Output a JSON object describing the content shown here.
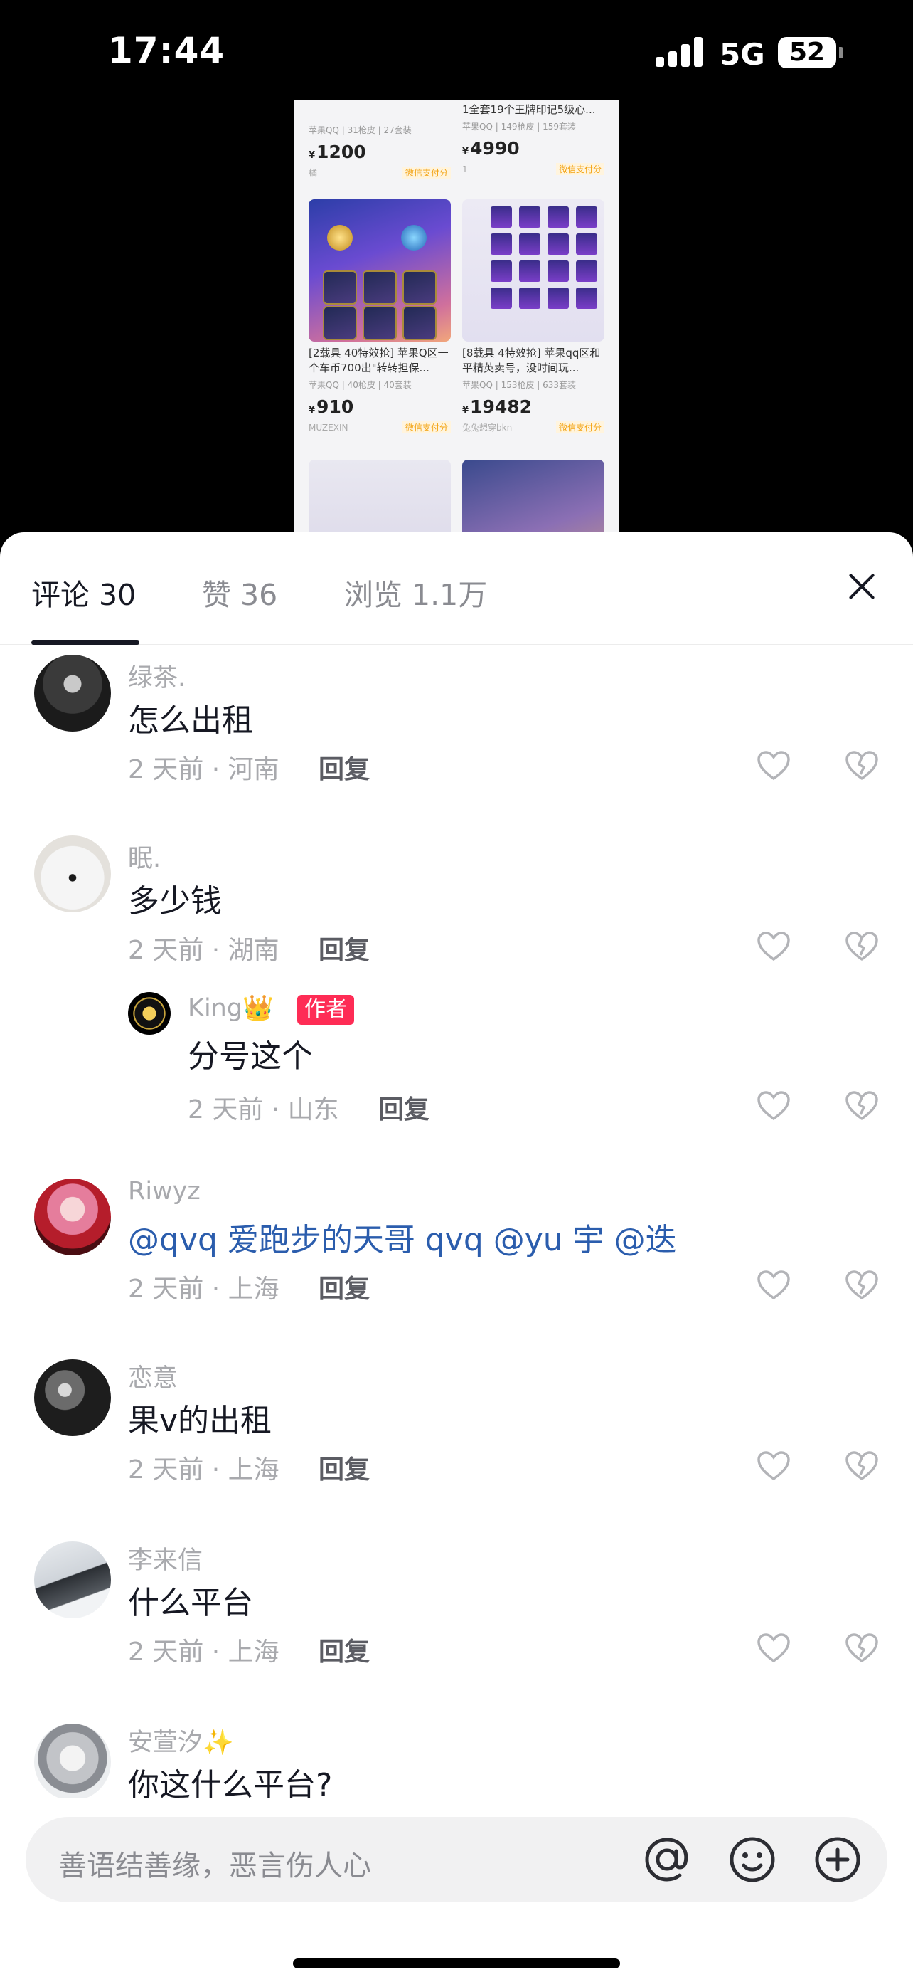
{
  "status_bar": {
    "time": "17:44",
    "network": "5G",
    "battery": "52"
  },
  "preview": {
    "cards": [
      {
        "title": "",
        "meta": "苹果QQ | 31枪皮 | 27套装",
        "price": "1200",
        "seller": "橘",
        "pay": "微信支付分"
      },
      {
        "title": "1全套19个王牌印记5级心...",
        "meta": "苹果QQ | 149枪皮 | 159套装",
        "price": "4990",
        "seller": "1",
        "pay": "微信支付分"
      },
      {
        "title": "[2载具 40特效抢] 苹果Q区一个车币700出\"转转担保...",
        "meta": "苹果QQ | 40枪皮 | 40套装",
        "price": "910",
        "seller": "MUZEXIN",
        "pay": "微信支付分"
      },
      {
        "title": "[8载具 4特效抢] 苹果qq区和平精英卖号，没时间玩...",
        "meta": "苹果QQ | 153枪皮 | 633套装",
        "price": "19482",
        "seller": "兔兔想穿bkn",
        "pay": "微信支付分"
      }
    ],
    "currency": "¥"
  },
  "tabs": {
    "comments": "评论 30",
    "likes": "赞 36",
    "views": "浏览 1.1万"
  },
  "comments": [
    {
      "user": "绿茶.",
      "text": "怎么出租",
      "meta": "2 天前 · 河南",
      "reply": "回复"
    },
    {
      "user": "眠.",
      "text": "多少钱",
      "meta": "2 天前 · 湖南",
      "reply": "回复",
      "sub": {
        "user": "King👑",
        "badge": "作者",
        "text": "分号这个",
        "meta": "2 天前 · 山东",
        "reply": "回复"
      }
    },
    {
      "user": "Riwyz",
      "text": "@qvq 爱跑步的天哥 qvq @yu 宇 @迭",
      "meta": "2 天前 · 上海",
      "reply": "回复"
    },
    {
      "user": "恋意",
      "text": "果v的出租",
      "meta": "2 天前 · 上海",
      "reply": "回复"
    },
    {
      "user": "李来信",
      "text": "什么平台",
      "meta": "2 天前 · 上海",
      "reply": "回复"
    },
    {
      "user": "安萱汐✨",
      "text": "你这什么平台?",
      "meta": "",
      "reply": ""
    }
  ],
  "input": {
    "placeholder": "善语结善缘，恶言伤人心"
  },
  "icons": {
    "like": "heart-outline-icon",
    "dislike": "broken-heart-icon",
    "at": "at-icon",
    "emoji": "emoji-icon",
    "add": "plus-circle-icon",
    "close": "close-icon"
  },
  "colors": {
    "author_badge": "#fe2c55",
    "mention": "#2b5dad",
    "pay_badge": "#f3a312"
  }
}
